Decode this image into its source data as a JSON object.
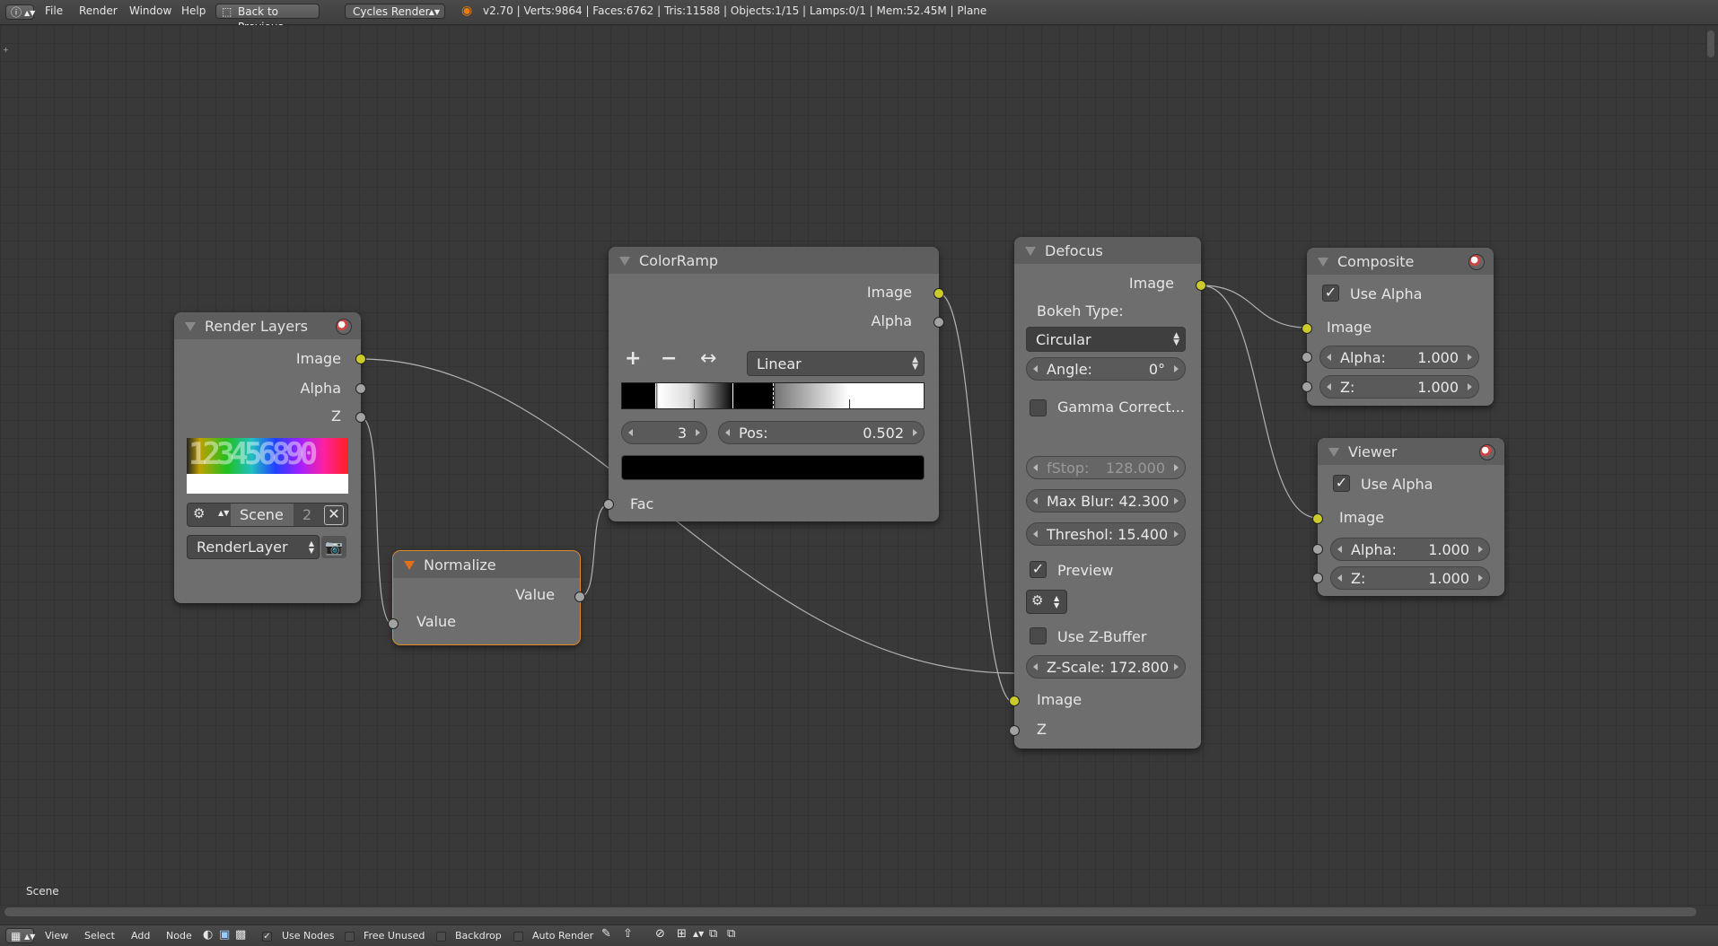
{
  "topbar": {
    "menus": [
      "File",
      "Render",
      "Window",
      "Help"
    ],
    "back_button": "Back to Previous",
    "engine": "Cycles Render",
    "stats": "v2.70 | Verts:9864 | Faces:6762 | Tris:11588 | Objects:1/15 | Lamps:0/1 | Mem:52.45M | Plane"
  },
  "editor": {
    "scene_label": "Scene"
  },
  "nodes": {
    "render_layers": {
      "title": "Render Layers",
      "outputs": [
        "Image",
        "Alpha",
        "Z"
      ],
      "preview_text": "123456890",
      "scene": "Scene",
      "scene_users": "2",
      "layer": "RenderLayer"
    },
    "normalize": {
      "title": "Normalize",
      "output": "Value",
      "input": "Value"
    },
    "colorramp": {
      "title": "ColorRamp",
      "outputs": [
        "Image",
        "Alpha"
      ],
      "interpolation": "Linear",
      "active_stop": "3",
      "pos_label": "Pos:",
      "pos_value": "0.502",
      "input": "Fac",
      "add_symbol": "+",
      "remove_symbol": "−",
      "flip_symbol": "↔"
    },
    "defocus": {
      "title": "Defocus",
      "output": "Image",
      "bokeh_label": "Bokeh Type:",
      "bokeh_type": "Circular",
      "angle_label": "Angle:",
      "angle_value": "0°",
      "gamma_label": "Gamma Correct...",
      "gamma_checked": false,
      "fstop_label": "fStop:",
      "fstop_value": "128.000",
      "maxblur": "Max Blur: 42.300",
      "threshold": "Threshol: 15.400",
      "preview_label": "Preview",
      "preview_checked": true,
      "zbuffer_label": "Use Z-Buffer",
      "zbuffer_checked": false,
      "zscale": "Z-Scale: 172.800",
      "inputs": [
        "Image",
        "Z"
      ]
    },
    "composite": {
      "title": "Composite",
      "use_alpha_label": "Use Alpha",
      "use_alpha_checked": true,
      "input_image": "Image",
      "alpha_label": "Alpha:",
      "alpha_value": "1.000",
      "z_label": "Z:",
      "z_value": "1.000"
    },
    "viewer": {
      "title": "Viewer",
      "use_alpha_label": "Use Alpha",
      "use_alpha_checked": true,
      "input_image": "Image",
      "alpha_label": "Alpha:",
      "alpha_value": "1.000",
      "z_label": "Z:",
      "z_value": "1.000"
    }
  },
  "bottombar": {
    "menus": [
      "View",
      "Select",
      "Add",
      "Node"
    ],
    "use_nodes": "Use Nodes",
    "free_unused": "Free Unused",
    "backdrop": "Backdrop",
    "auto_render": "Auto Render"
  },
  "colors": {
    "socket_image": "#cbcb2c",
    "socket_value": "#a2a2a2",
    "selection": "#e08a2a"
  }
}
